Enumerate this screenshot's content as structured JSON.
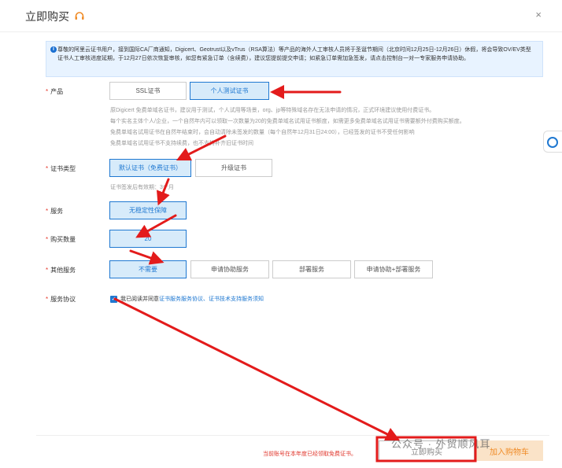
{
  "dialog": {
    "title": "立即购买",
    "close_glyph": "×"
  },
  "notice": {
    "text": "尊敬的阿里云证书用户，接到国际CA厂商通知，Digicert、Geotrust以及vTrus（RSA算法）等产品的海外人工审核人员将于圣诞节期间（北京时间12月25日-12月26日）休假，将会导致OV/EV类型证书人工审核进度延期，于12月27日依次恢复审核，如您有紧急订单（含续费），建议您提前提交申请；如紧急订单需加急签发，请点击控制台一对一专家服务申请协助。"
  },
  "product": {
    "label": "产品",
    "options": [
      "SSL证书",
      "个人测试证书"
    ],
    "selected": 1,
    "desc": [
      "原Digicert 免费单域名证书，建议用于测试，个人试用等场景，org、jp等特殊域名存在无法申请的情况，正式环境建议使用付费证书。",
      "每个实名主体个人/企业，一个自然年内可以领取一次数量为20的免费单域名试用证书额度，如需更多免费单域名试用证书需要额外付费购买额度。",
      "免费单域名试用证书在自然年结束时，会自动清除未签发的数量（每个自然年12月31日24:00），已经签发的证书不受任何影响",
      "免费单域名试用证书不支持续费，也不支持补齐旧证书时间"
    ]
  },
  "cert_type": {
    "label": "证书类型",
    "options": [
      "默认证书（免费证书）",
      "升级证书"
    ],
    "selected": 0,
    "desc": "证书签发后有效期：3个月"
  },
  "service": {
    "label": "服务",
    "value": "无稳定性保障"
  },
  "quantity": {
    "label": "购买数量",
    "value": "20"
  },
  "other_services": {
    "label": "其他服务",
    "options": [
      "不需要",
      "申请协助服务",
      "部署服务",
      "申请协助+部署服务"
    ],
    "selected": 0
  },
  "agreement": {
    "label": "服务协议",
    "prefix": "我已阅读并同意",
    "link1": "证书服务服务协议",
    "sep": "、",
    "link2": "证书技术支持服务须知",
    "checked": true
  },
  "footer": {
    "warning": "当前账号在本年度已经领取免费证书。",
    "buy_label": "立即购买",
    "cart_label": "加入购物车",
    "watermark": "公众号 · 外贸顺风耳"
  },
  "colors": {
    "accent": "#1f78d1",
    "arrow": "#e31b1b",
    "cart": "#f08c28"
  }
}
